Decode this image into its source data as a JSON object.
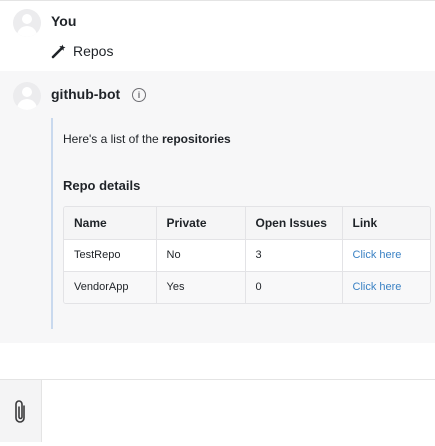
{
  "user_message": {
    "author": "You",
    "text": "Repos"
  },
  "bot_message": {
    "author": "github-bot",
    "intro_prefix": "Here's a list of the ",
    "intro_bold": "repositories",
    "details_title": "Repo details",
    "table": {
      "headers": [
        "Name",
        "Private",
        "Open Issues",
        "Link"
      ],
      "rows": [
        [
          "TestRepo",
          "No",
          "3",
          "Click here"
        ],
        [
          "VendorApp",
          "Yes",
          "0",
          "Click here"
        ]
      ]
    }
  },
  "composer": {
    "placeholder": ""
  },
  "colors": {
    "link": "#3b82c4",
    "card_border": "#c9d9ee",
    "bot_bg": "#f7f7f8"
  }
}
